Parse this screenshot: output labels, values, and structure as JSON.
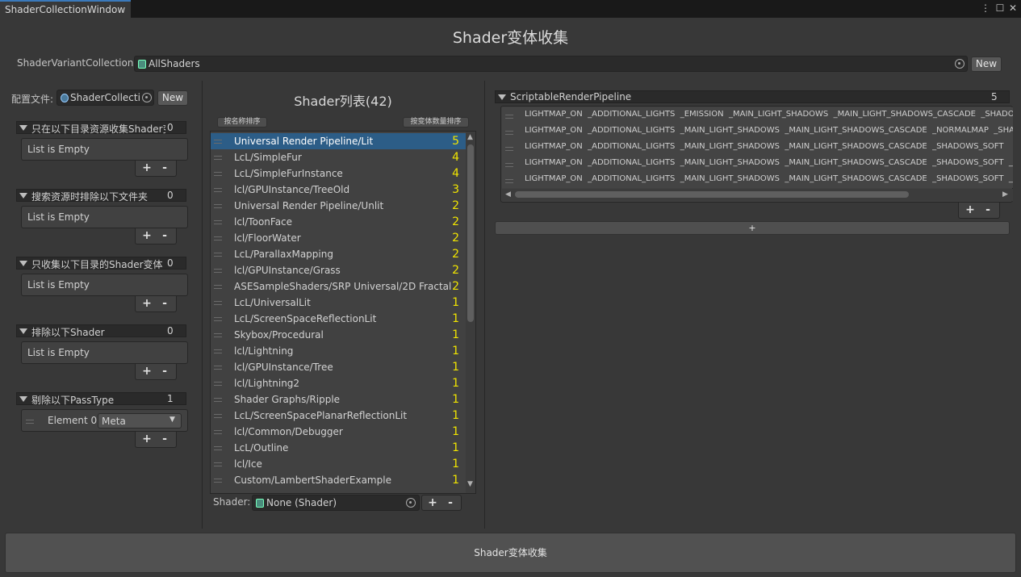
{
  "window": {
    "tab_title": "ShaderCollectionWindow",
    "main_title": "Shader变体收集"
  },
  "svc": {
    "label": "ShaderVariantCollection:",
    "value": "AllShaders",
    "new_label": "New"
  },
  "left": {
    "config_label": "配置文件:",
    "config_value": "ShaderCollecti",
    "new_label": "New",
    "foldouts": [
      {
        "title": "只在以下目录资源收集Shader变",
        "count": "0",
        "empty_text": "List is Empty"
      },
      {
        "title": "搜索资源时排除以下文件夹",
        "count": "0",
        "empty_text": "List is Empty"
      },
      {
        "title": "只收集以下目录的Shader变体",
        "count": "0",
        "empty_text": "List is Empty"
      },
      {
        "title": "排除以下Shader",
        "count": "0",
        "empty_text": "List is Empty"
      },
      {
        "title": "剔除以下PassType",
        "count": "1",
        "element_label": "Element 0",
        "element_value": "Meta"
      }
    ],
    "plus": "+",
    "minus": "-"
  },
  "middle": {
    "title": "Shader列表(42)",
    "sort_by_name": "按名称排序",
    "sort_by_count": "按变体数量排序",
    "shaders": [
      {
        "name": "Universal Render Pipeline/Lit",
        "count": "5"
      },
      {
        "name": "LcL/SimpleFur",
        "count": "4"
      },
      {
        "name": "LcL/SimpleFurInstance",
        "count": "4"
      },
      {
        "name": "lcl/GPUInstance/TreeOld",
        "count": "3"
      },
      {
        "name": "Universal Render Pipeline/Unlit",
        "count": "2"
      },
      {
        "name": "lcl/ToonFace",
        "count": "2"
      },
      {
        "name": "lcl/FloorWater",
        "count": "2"
      },
      {
        "name": "LcL/ParallaxMapping",
        "count": "2"
      },
      {
        "name": "lcl/GPUInstance/Grass",
        "count": "2"
      },
      {
        "name": "ASESampleShaders/SRP Universal/2D Fractal",
        "count": "2"
      },
      {
        "name": "LcL/UniversalLit",
        "count": "1"
      },
      {
        "name": "LcL/ScreenSpaceReflectionLit",
        "count": "1"
      },
      {
        "name": "Skybox/Procedural",
        "count": "1"
      },
      {
        "name": "lcl/Lightning",
        "count": "1"
      },
      {
        "name": "lcl/GPUInstance/Tree",
        "count": "1"
      },
      {
        "name": "lcl/Lightning2",
        "count": "1"
      },
      {
        "name": "Shader Graphs/Ripple",
        "count": "1"
      },
      {
        "name": "LcL/ScreenSpacePlanarReflectionLit",
        "count": "1"
      },
      {
        "name": "lcl/Common/Debugger",
        "count": "1"
      },
      {
        "name": "LcL/Outline",
        "count": "1"
      },
      {
        "name": "lcl/Ice",
        "count": "1"
      },
      {
        "name": "Custom/LambertShaderExample",
        "count": "1"
      }
    ],
    "shader_label": "Shader:",
    "shader_value": "None (Shader)",
    "plus": "+",
    "minus": "-"
  },
  "right": {
    "foldout_title": "ScriptableRenderPipeline",
    "foldout_count": "5",
    "variants": [
      "LIGHTMAP_ON  _ADDITIONAL_LIGHTS  _EMISSION  _MAIN_LIGHT_SHADOWS  _MAIN_LIGHT_SHADOWS_CASCADE  _SHADOWS_SOFT",
      "LIGHTMAP_ON  _ADDITIONAL_LIGHTS  _MAIN_LIGHT_SHADOWS  _MAIN_LIGHT_SHADOWS_CASCADE  _NORMALMAP  _SHADOWS_SOFT",
      "LIGHTMAP_ON  _ADDITIONAL_LIGHTS  _MAIN_LIGHT_SHADOWS  _MAIN_LIGHT_SHADOWS_CASCADE  _SHADOWS_SOFT",
      "LIGHTMAP_ON  _ADDITIONAL_LIGHTS  _MAIN_LIGHT_SHADOWS  _MAIN_LIGHT_SHADOWS_CASCADE  _SHADOWS_SOFT  _SPECULAR",
      "LIGHTMAP_ON  _ADDITIONAL_LIGHTS  _MAIN_LIGHT_SHADOWS  _MAIN_LIGHT_SHADOWS_CASCADE  _SHADOWS_SOFT  _SURFACE"
    ],
    "plus": "+",
    "minus": "-",
    "add_pipeline": "+"
  },
  "footer": {
    "collect_button": "Shader变体收集"
  },
  "colors": {
    "accent": "#3a79bb",
    "selection": "#2c5d87",
    "count_yellow": "#f1e500",
    "background": "#383838"
  }
}
